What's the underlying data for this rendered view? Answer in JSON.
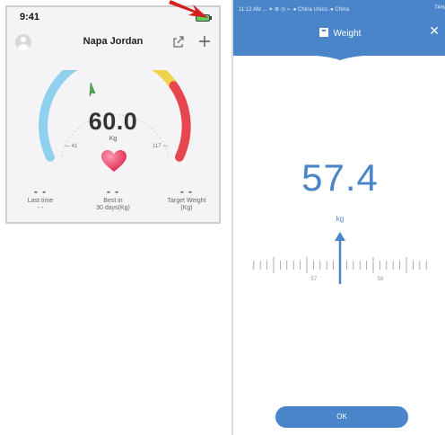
{
  "left_screen": {
    "status_time": "9:41",
    "user_name": "Napa Jordan",
    "weight": "60.0",
    "unit": "Kg",
    "range_min": "41",
    "range_max": "117",
    "stats": [
      {
        "value": "- -",
        "label_line1": "Last time",
        "label_line2": "- -"
      },
      {
        "value": "- -",
        "label_line1": "Best in",
        "label_line2": "30 days(Kg)"
      },
      {
        "value": "- -",
        "label_line1": "Target Weight",
        "label_line2": "(Kg)"
      }
    ],
    "icons": {
      "avatar": "user-avatar-icon",
      "share": "share-icon",
      "add": "plus-icon",
      "heart": "heart-icon"
    },
    "colors": {
      "gauge_blue": "#8fd0ef",
      "gauge_green": "#7cc36a",
      "gauge_yellow": "#f0d24c",
      "gauge_red": "#e8464e",
      "heart": "#e83b5a"
    }
  },
  "right_screen": {
    "status_bar": "11:12 AM ... ✶ ⚙ ◷ ⌁ .● China Unico  .● China",
    "battery": "74%",
    "title": "Weight",
    "close_symbol": "✕",
    "weight": "57.4",
    "unit": "kg",
    "ruler_labels": [
      "57",
      "58"
    ],
    "ok_label": "OK",
    "colors": {
      "primary": "#4a85c9"
    }
  }
}
